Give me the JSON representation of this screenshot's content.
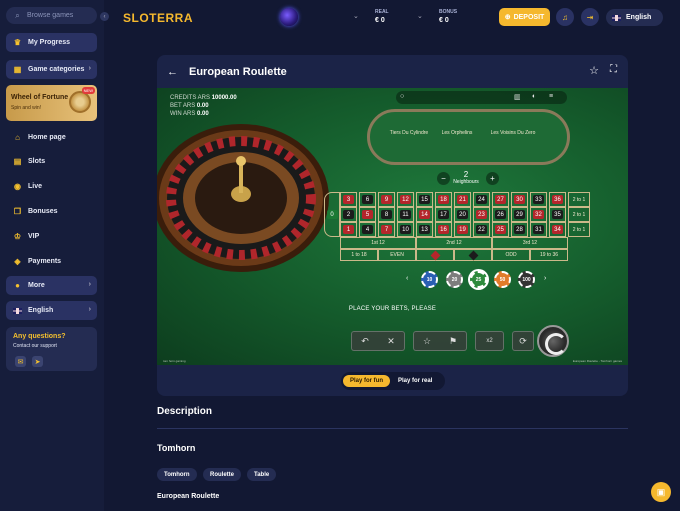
{
  "sidebar": {
    "search_placeholder": "Browse games",
    "progress": "My Progress",
    "categories": "Game categories",
    "wheel_title": "Wheel of Fortune",
    "wheel_sub": "Spin and win!",
    "wheel_badge": "NEW",
    "items": [
      {
        "label": "Home page",
        "icon": "home-icon"
      },
      {
        "label": "Slots",
        "icon": "slots-icon"
      },
      {
        "label": "Live",
        "icon": "live-icon"
      },
      {
        "label": "Bonuses",
        "icon": "gift-icon"
      },
      {
        "label": "VIP",
        "icon": "crown-icon"
      },
      {
        "label": "Payments",
        "icon": "wallet-icon"
      }
    ],
    "more": "More",
    "language": "English",
    "questions": "Any questions?",
    "support": "Contact our support"
  },
  "header": {
    "logo": "SLOTERRA",
    "real_label": "REAL",
    "real_amount": "€ 0",
    "bonus_label": "BONUS",
    "bonus_amount": "€ 0",
    "deposit": "DEPOSIT",
    "language": "English"
  },
  "game": {
    "title": "European Roulette",
    "credits_label": "CREDITS ARS",
    "credits_value": "10000.00",
    "bet_label": "BET ARS",
    "bet_value": "0.00",
    "win_label": "WIN ARS",
    "win_value": "0.00",
    "race": {
      "tiers": "Tiers Du Cylindre",
      "orphelins": "Les Orphelins",
      "voisins": "Les Voisins Du Zero"
    },
    "neighbours_count": "2",
    "neighbours_label": "Neighbours",
    "rows": [
      [
        "3",
        "6",
        "9",
        "12",
        "15",
        "18",
        "21",
        "24",
        "27",
        "30",
        "33",
        "36"
      ],
      [
        "2",
        "5",
        "8",
        "11",
        "14",
        "17",
        "20",
        "23",
        "26",
        "29",
        "32",
        "35"
      ],
      [
        "1",
        "4",
        "7",
        "10",
        "13",
        "16",
        "19",
        "22",
        "25",
        "28",
        "31",
        "34"
      ]
    ],
    "red_numbers": [
      "1",
      "3",
      "5",
      "7",
      "9",
      "12",
      "14",
      "16",
      "18",
      "19",
      "21",
      "23",
      "25",
      "27",
      "30",
      "32",
      "34",
      "36"
    ],
    "zero": "0",
    "column_bet": "2 to 1",
    "dozens": [
      "1st 12",
      "2nd 12",
      "3rd 12"
    ],
    "outside": [
      "1 to 18",
      "EVEN",
      "",
      "",
      "ODD",
      "19 to 36"
    ],
    "chips": [
      "10",
      "20",
      "25",
      "50",
      "100"
    ],
    "place_bets": "PLACE YOUR BETS, PLEASE",
    "double": "x2",
    "provider_footer": "tom horn gaming",
    "game_footer": "European Roulette - Tomhorn games"
  },
  "modes": {
    "fun": "Play for fun",
    "real": "Play for real"
  },
  "description": {
    "title": "Description",
    "provider": "Tomhorn",
    "tags": [
      "Tomhorn",
      "Roulette",
      "Table"
    ],
    "game_name": "European Roulette"
  }
}
